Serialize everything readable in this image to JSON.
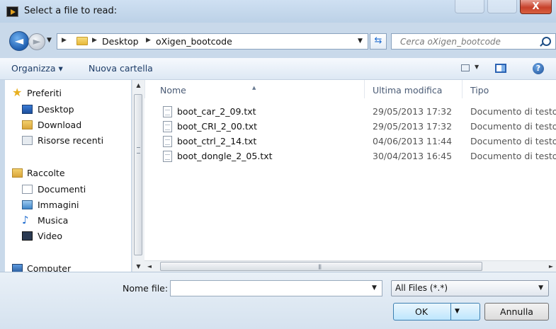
{
  "window": {
    "title": "Select a file to read:",
    "close_label": "X"
  },
  "nav": {
    "back_glyph": "◄",
    "forward_glyph": "►",
    "breadcrumb": [
      "Desktop",
      "oXigen_bootcode"
    ],
    "search_placeholder": "Cerca oXigen_bootcode"
  },
  "toolbar": {
    "organize_label": "Organizza ▾",
    "new_folder_label": "Nuova cartella",
    "help_label": "?"
  },
  "sidebar": {
    "items": [
      {
        "label": "Preferiti",
        "icon": "star-icon"
      },
      {
        "label": "Desktop",
        "icon": "desktop-icon"
      },
      {
        "label": "Download",
        "icon": "download-icon"
      },
      {
        "label": "Risorse recenti",
        "icon": "recent-places-icon"
      },
      {
        "label": "Raccolte",
        "icon": "libraries-icon"
      },
      {
        "label": "Documenti",
        "icon": "documents-icon"
      },
      {
        "label": "Immagini",
        "icon": "pictures-icon"
      },
      {
        "label": "Musica",
        "icon": "music-icon"
      },
      {
        "label": "Video",
        "icon": "video-icon"
      },
      {
        "label": "Computer",
        "icon": "computer-icon"
      }
    ]
  },
  "columns": {
    "name": "Nome",
    "modified": "Ultima modifica",
    "type": "Tipo"
  },
  "files": [
    {
      "name": "boot_car_2_09.txt",
      "modified": "29/05/2013 17:32",
      "type": "Documento di testo"
    },
    {
      "name": "boot_CRI_2_00.txt",
      "modified": "29/05/2013 17:32",
      "type": "Documento di testo"
    },
    {
      "name": "boot_ctrl_2_14.txt",
      "modified": "04/06/2013 11:44",
      "type": "Documento di testo"
    },
    {
      "name": "boot_dongle_2_05.txt",
      "modified": "30/04/2013 16:45",
      "type": "Documento di testo"
    }
  ],
  "bottom": {
    "filename_label": "Nome file:",
    "filename_value": "",
    "filetype_value": "All Files (*.*)",
    "ok_label": "OK",
    "cancel_label": "Annulla"
  },
  "colors": {
    "accent": "#1f5fb0",
    "chrome": "#c9d9ea",
    "close": "#c7412b"
  }
}
